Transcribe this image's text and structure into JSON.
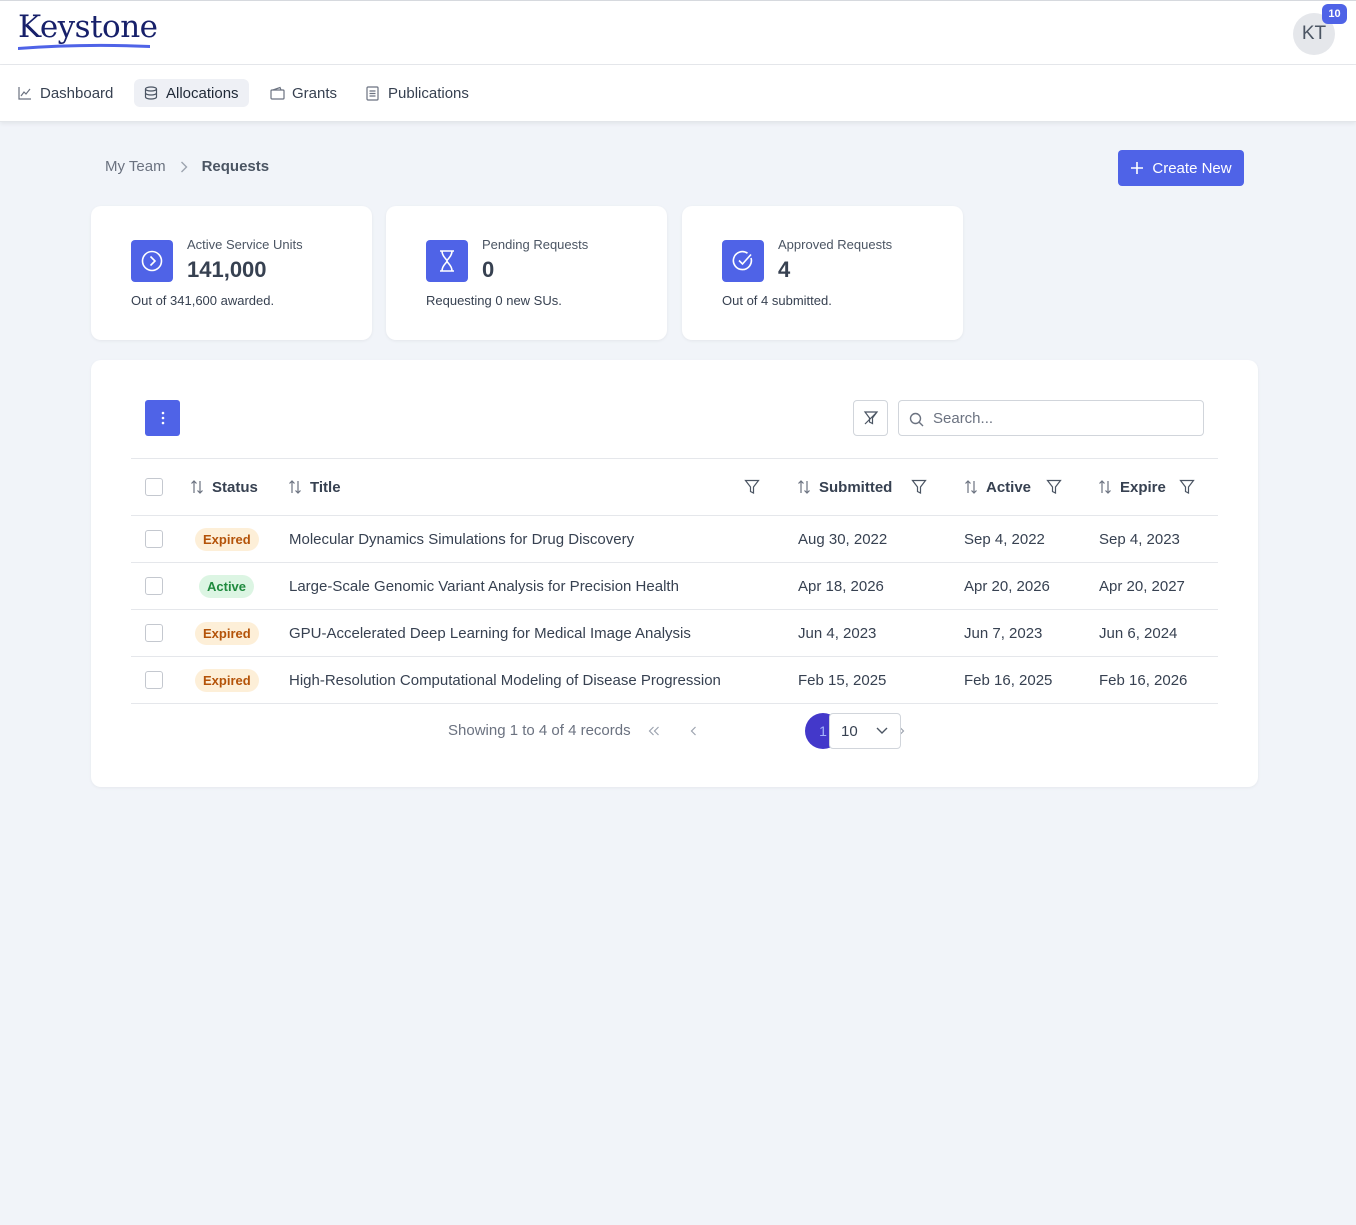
{
  "header": {
    "logo_text": "Keystone",
    "avatar_initials": "KT",
    "notification_count": "10"
  },
  "nav": {
    "items": [
      {
        "label": "Dashboard",
        "icon": "chart-line-icon"
      },
      {
        "label": "Allocations",
        "icon": "database-icon",
        "active": true
      },
      {
        "label": "Grants",
        "icon": "wallet-icon"
      },
      {
        "label": "Publications",
        "icon": "document-icon"
      }
    ]
  },
  "breadcrumb": {
    "parent": "My Team",
    "current": "Requests"
  },
  "actions": {
    "create_label": "Create New"
  },
  "stats": [
    {
      "label": "Active Service Units",
      "value": "141,000",
      "sub": "Out of 341,600 awarded.",
      "icon": "chevron-right-circle-icon"
    },
    {
      "label": "Pending Requests",
      "value": "0",
      "sub": "Requesting 0 new SUs.",
      "icon": "hourglass-icon"
    },
    {
      "label": "Approved Requests",
      "value": "4",
      "sub": "Out of 4 submitted.",
      "icon": "check-circle-icon"
    }
  ],
  "table": {
    "search_placeholder": "Search...",
    "columns": {
      "status": "Status",
      "title": "Title",
      "submitted": "Submitted",
      "active": "Active",
      "expire": "Expire"
    },
    "rows": [
      {
        "status": "Expired",
        "title": "Molecular Dynamics Simulations for Drug Discovery",
        "submitted": "Aug 30, 2022",
        "active": "Sep 4, 2022",
        "expire": "Sep 4, 2023"
      },
      {
        "status": "Active",
        "title": "Large-Scale Genomic Variant Analysis for Precision Health",
        "submitted": "Apr 18, 2026",
        "active": "Apr 20, 2026",
        "expire": "Apr 20, 2027"
      },
      {
        "status": "Expired",
        "title": "GPU-Accelerated Deep Learning for Medical Image Analysis",
        "submitted": "Jun 4, 2023",
        "active": "Jun 7, 2023",
        "expire": "Jun 6, 2024"
      },
      {
        "status": "Expired",
        "title": "High-Resolution Computational Modeling of Disease Progression",
        "submitted": "Feb 15, 2025",
        "active": "Feb 16, 2025",
        "expire": "Feb 16, 2026"
      }
    ]
  },
  "pagination": {
    "summary": "Showing 1 to 4 of 4 records",
    "current_page": "1",
    "page_size": "10"
  },
  "colors": {
    "accent": "#4f63e7",
    "expired_bg": "#fdefd8",
    "expired_text": "#b45309",
    "active_bg": "#dcf5e3",
    "active_text": "#1f8a3e"
  }
}
